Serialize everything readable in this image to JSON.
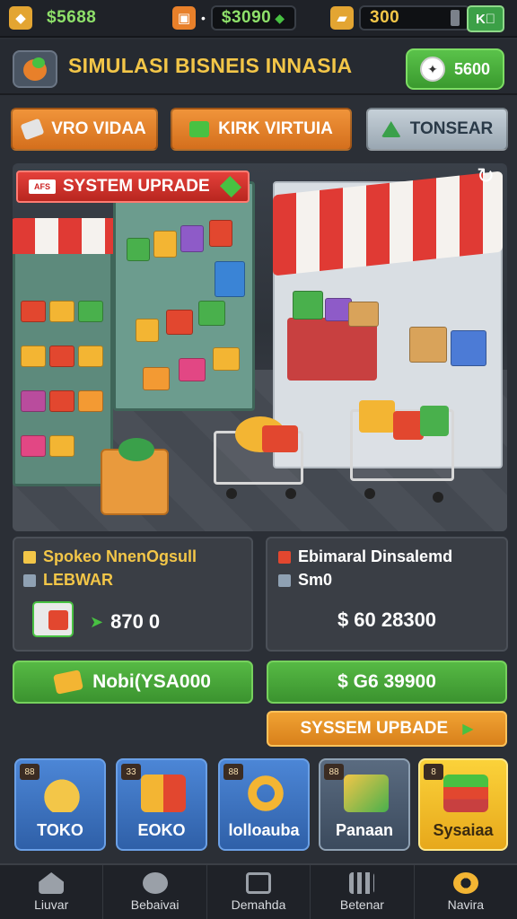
{
  "topbar": {
    "resources": [
      {
        "icon": "gold-cube-icon",
        "value": "$5688",
        "color": "#8ee06a"
      },
      {
        "icon": "bag-icon",
        "value": "$3090",
        "color": "#8ee06a"
      },
      {
        "icon": "gold-bar-icon",
        "value": "300",
        "color": "#f3c648"
      }
    ],
    "exit_icon": "exit-icon"
  },
  "header": {
    "title": "SIMULASI BISNEIS INNASIA",
    "cash": "5600"
  },
  "tabs": [
    {
      "label": "VRO VIDAA",
      "color": "#e8802a"
    },
    {
      "label": "KIRK VIRTUIA",
      "color": "#e8802a"
    },
    {
      "label": "TONSEAR",
      "color": "#aab8c4"
    }
  ],
  "scene": {
    "banner": "SYSTEM UPRADE"
  },
  "panels": {
    "left": {
      "line1": "Spokeo NnenOgsull",
      "line2": "LEBWAR",
      "value": "870 0"
    },
    "right": {
      "line1": "Ebimaral Dinsalemd",
      "line2": "Sm0",
      "value": "$ 60 28300"
    }
  },
  "actions": {
    "left_label": "Nobi(YSA000",
    "right_label": "$ G6 39900",
    "upgrade_label": "SYSSEM UPBADE"
  },
  "categories": [
    {
      "label": "TOKO",
      "badge": "88"
    },
    {
      "label": "EOKO",
      "badge": "33"
    },
    {
      "label": "lolloauba",
      "badge": "88"
    },
    {
      "label": "Panaan",
      "badge": "88"
    },
    {
      "label": "Sysaiaa",
      "badge": "8"
    }
  ],
  "bottom_nav": [
    {
      "label": "Liuvar",
      "icon": "home-icon"
    },
    {
      "label": "Bebaivai",
      "icon": "profile-icon"
    },
    {
      "label": "Demahda",
      "icon": "chart-icon"
    },
    {
      "label": "Betenar",
      "icon": "building-icon"
    },
    {
      "label": "Navira",
      "icon": "gear-icon"
    }
  ]
}
